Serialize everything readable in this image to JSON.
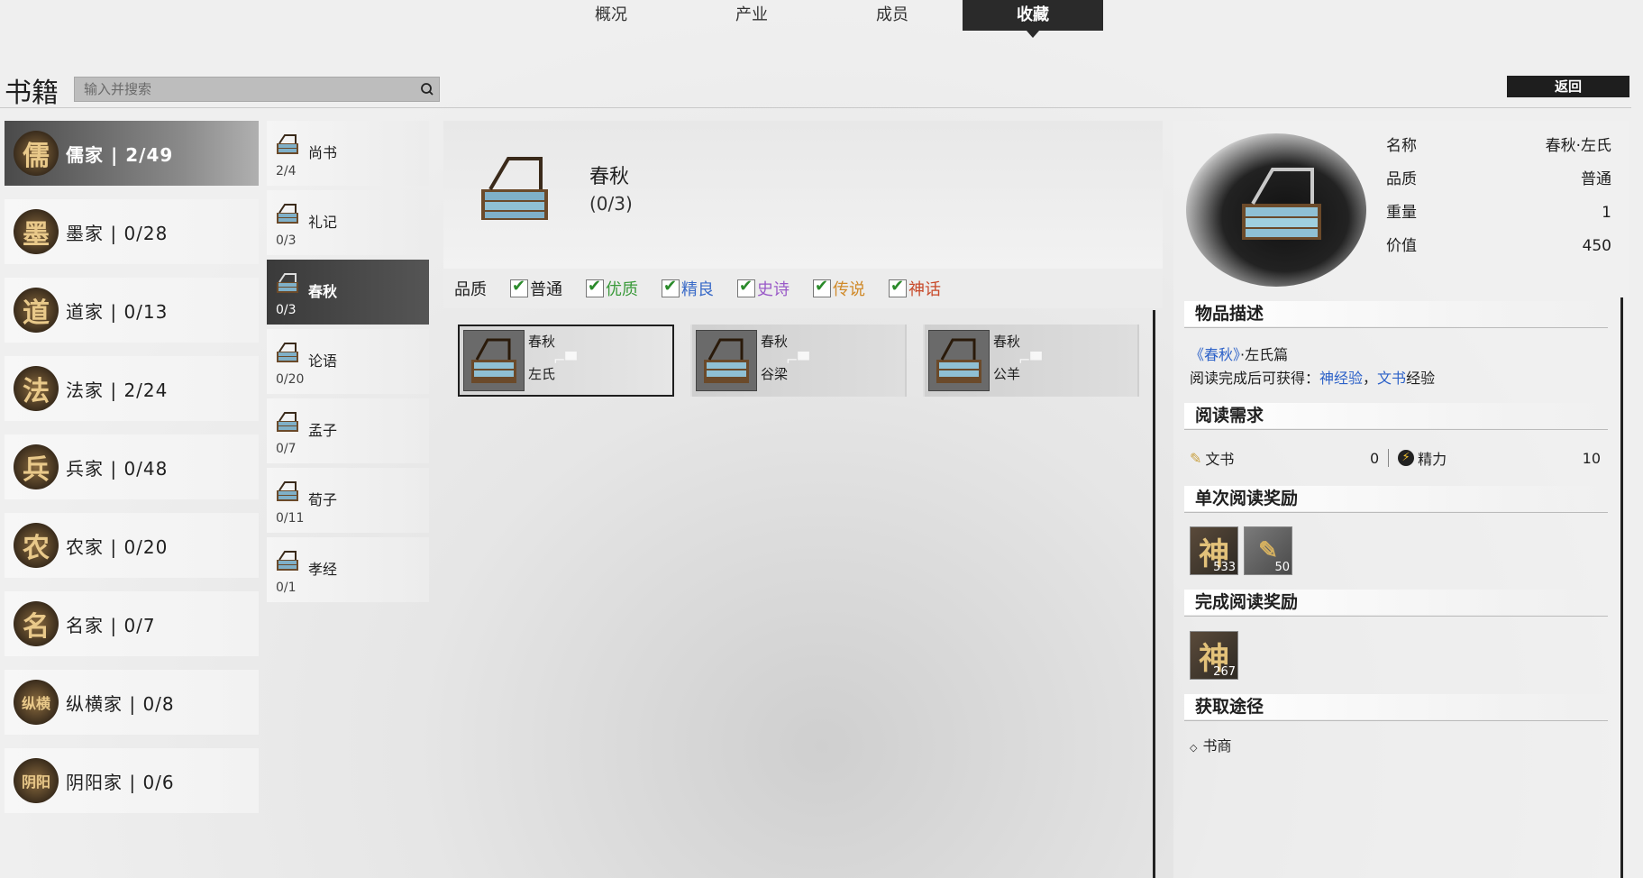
{
  "top_tabs": [
    "概况",
    "产业",
    "成员",
    "收藏"
  ],
  "active_tab_index": 3,
  "page_title": "书籍",
  "search": {
    "placeholder": "输入并搜索",
    "value": ""
  },
  "back_label": "返回",
  "schools": [
    {
      "emblem": "儒",
      "label": "儒家 | 2/49",
      "active": true
    },
    {
      "emblem": "墨",
      "label": "墨家 | 0/28"
    },
    {
      "emblem": "道",
      "label": "道家 | 0/13"
    },
    {
      "emblem": "法",
      "label": "法家 | 2/24"
    },
    {
      "emblem": "兵",
      "label": "兵家 | 0/48"
    },
    {
      "emblem": "农",
      "label": "农家 | 0/20"
    },
    {
      "emblem": "名",
      "label": "名家 | 0/7"
    },
    {
      "emblem": "纵横",
      "label": "纵横家 | 0/8"
    },
    {
      "emblem": "阴阳",
      "label": "阴阳家 | 0/6"
    }
  ],
  "books": [
    {
      "name": "尚书",
      "count": "2/4"
    },
    {
      "name": "礼记",
      "count": "0/3"
    },
    {
      "name": "春秋",
      "count": "0/3",
      "active": true
    },
    {
      "name": "论语",
      "count": "0/20"
    },
    {
      "name": "孟子",
      "count": "0/7"
    },
    {
      "name": "荀子",
      "count": "0/11"
    },
    {
      "name": "孝经",
      "count": "0/1"
    }
  ],
  "detail": {
    "title": "春秋",
    "count": "(0/3)",
    "quality_label": "品质",
    "quality_filters": [
      {
        "label": "普通",
        "color": "#1f1f1f"
      },
      {
        "label": "优质",
        "color": "#3a9a3a"
      },
      {
        "label": "精良",
        "color": "#3a6bc8"
      },
      {
        "label": "史诗",
        "color": "#9a5ac8"
      },
      {
        "label": "传说",
        "color": "#d08a2a"
      },
      {
        "label": "神话",
        "color": "#c84a2a"
      }
    ],
    "cards": [
      {
        "title": "春秋",
        "sub": "左氏",
        "selected": true
      },
      {
        "title": "春秋",
        "sub": "谷梁"
      },
      {
        "title": "春秋",
        "sub": "公羊"
      }
    ]
  },
  "item": {
    "props": [
      {
        "k": "名称",
        "v": "春秋·左氏"
      },
      {
        "k": "品质",
        "v": "普通"
      },
      {
        "k": "重量",
        "v": "1"
      },
      {
        "k": "价值",
        "v": "450"
      }
    ],
    "sections": {
      "desc": "物品描述",
      "req": "阅读需求",
      "single": "单次阅读奖励",
      "complete": "完成阅读奖励",
      "source": "获取途径"
    },
    "desc_book": "《春秋》",
    "desc_suffix": "·左氏篇",
    "desc2_prefix": "阅读完成后可获得：",
    "desc2_exp1": "神经验",
    "desc2_sep": "，",
    "desc2_exp2": "文书",
    "desc2_suffix": "经验",
    "req": [
      {
        "label": "文书",
        "value": "0"
      },
      {
        "label": "精力",
        "value": "10"
      }
    ],
    "single_rewards": [
      {
        "glyph": "神",
        "num": "533"
      },
      {
        "glyph": "✎",
        "num": "50"
      }
    ],
    "complete_rewards": [
      {
        "glyph": "神",
        "num": "267"
      }
    ],
    "source": "书商"
  }
}
